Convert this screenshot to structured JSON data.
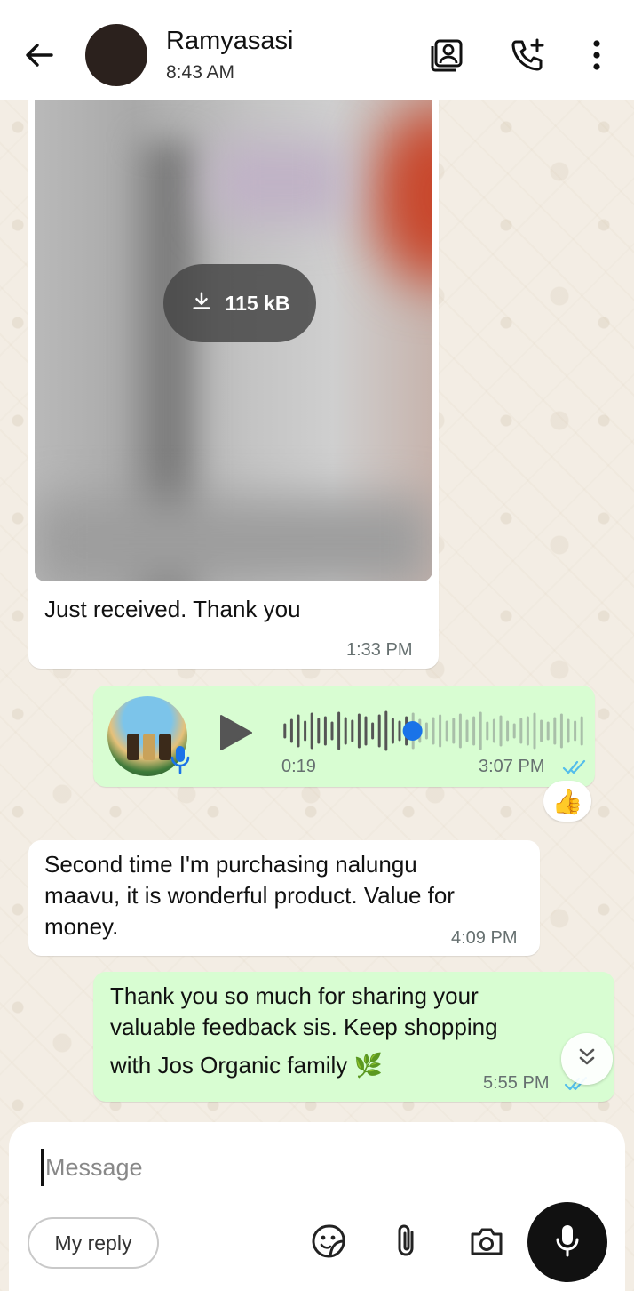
{
  "header": {
    "contact_name": "Ramyasasi",
    "status": "8:43 AM"
  },
  "messages": {
    "image_msg": {
      "download_size": "115 kB",
      "caption": "Just received. Thank you",
      "time": "1:33 PM"
    },
    "voice_msg": {
      "duration": "0:19",
      "time": "3:07 PM",
      "progress": 0.42,
      "reaction": "👍"
    },
    "text_msg_1": {
      "lines": [
        "Second time I'm purchasing nalungu",
        "maavu, it is wonderful product. Value for",
        "money."
      ],
      "time": "4:09 PM"
    },
    "text_msg_2": {
      "lines": [
        "Thank you so much for sharing your",
        "valuable feedback sis. Keep shopping",
        "with Jos Organic family 🌿"
      ],
      "time": "5:55 PM"
    }
  },
  "composer": {
    "placeholder": "Message",
    "quick_reply": "My reply"
  },
  "colors": {
    "outgoing_bubble": "#d8fdd2",
    "incoming_bubble": "#ffffff",
    "read_ticks": "#53bdeb",
    "voice_progress": "#1a73e8"
  }
}
